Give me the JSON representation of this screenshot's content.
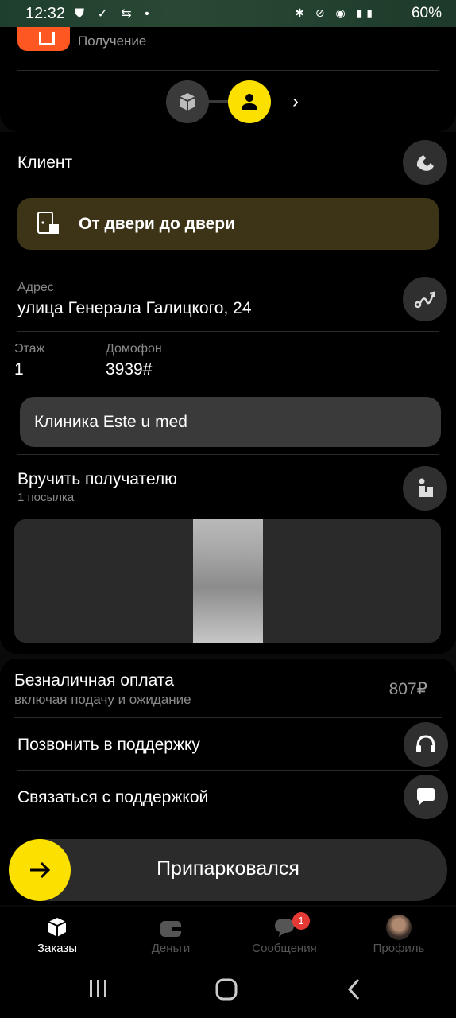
{
  "status_bar": {
    "time": "12:32",
    "battery": "60%"
  },
  "header": {
    "stage_label": "Получение"
  },
  "client": {
    "title": "Клиент",
    "delivery_type": "От двери до двери",
    "address_label": "Адрес",
    "address_value": "улица Генерала Галицкого, 24",
    "floor_label": "Этаж",
    "floor_value": "1",
    "intercom_label": "Домофон",
    "intercom_value": "3939#",
    "comment": "Клиника Este u med"
  },
  "handover": {
    "title": "Вручить получателю",
    "subtitle": "1 посылка"
  },
  "payment": {
    "title": "Безналичная оплата",
    "subtitle": "включая подачу и ожидание",
    "price": "807₽"
  },
  "support": {
    "call_label": "Позвонить в поддержку",
    "chat_label": "Связаться с поддержкой"
  },
  "action": {
    "parked_label": "Припарковался"
  },
  "bottom_nav": {
    "items": [
      {
        "label": "Заказы"
      },
      {
        "label": "Деньги"
      },
      {
        "label": "Сообщения"
      },
      {
        "label": "Профиль"
      }
    ],
    "messages_badge": "1"
  },
  "colors": {
    "accent": "#fce000",
    "d2d_bg": "#3d3418",
    "badge": "#e53935"
  }
}
